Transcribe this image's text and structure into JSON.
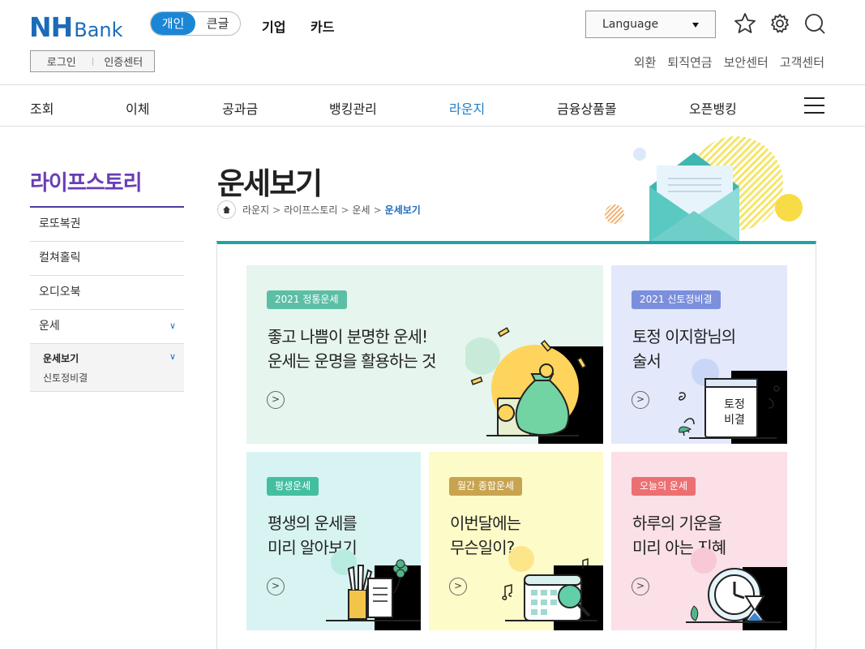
{
  "header": {
    "logo_nh": "NH",
    "logo_bank": "Bank",
    "mode_personal": "개인",
    "mode_large_text": "큰글",
    "link_business": "기업",
    "link_card": "카드",
    "language_label": "Language",
    "login": "로그인",
    "cert_center": "인증센터",
    "util_links": [
      "외환",
      "퇴직연금",
      "보안센터",
      "고객센터"
    ]
  },
  "gnb": {
    "items": [
      "조회",
      "이체",
      "공과금",
      "뱅킹관리",
      "라운지",
      "금융상품몰",
      "오픈뱅킹"
    ],
    "active": "라운지"
  },
  "sidebar": {
    "title": "라이프스토리",
    "items": [
      "로또복권",
      "컬쳐홀릭",
      "오디오북",
      "운세"
    ],
    "sub_items": [
      "운세보기",
      "신토정비결"
    ]
  },
  "page": {
    "title": "운세보기",
    "breadcrumb": [
      "라운지",
      "라이프스토리",
      "운세",
      "운세보기"
    ]
  },
  "cards": [
    {
      "badge": "2021 정통운세",
      "lines": [
        "좋고 나쁨이 분명한 운세!",
        "운세는 운명을 활용하는 것"
      ],
      "bg": "#e6f5ee",
      "badge_color": "#5cbfa5"
    },
    {
      "badge": "2021 신토정비결",
      "lines": [
        "토정 이지함님의",
        "술서"
      ],
      "bg": "#e3e9fb",
      "badge_color": "#7b8fdc",
      "book_label": [
        "토정",
        "비결"
      ]
    },
    {
      "badge": "평생운세",
      "lines": [
        "평생의 운세를",
        "미리 알아보기"
      ],
      "bg": "#d7f4f2",
      "badge_color": "#43bfa0"
    },
    {
      "badge": "월간 종합운세",
      "lines": [
        "이번달에는",
        "무슨일이?"
      ],
      "bg": "#fdfbc8",
      "badge_color": "#c8a450"
    },
    {
      "badge": "오늘의 운세",
      "lines": [
        "하루의 기운을",
        "미리 아는 지혜"
      ],
      "bg": "#fbe0e7",
      "badge_color": "#ec6f72"
    }
  ],
  "icons": [
    "star-icon",
    "gear-icon",
    "search-icon",
    "menu-icon",
    "home-icon",
    "arrow-right-icon"
  ]
}
